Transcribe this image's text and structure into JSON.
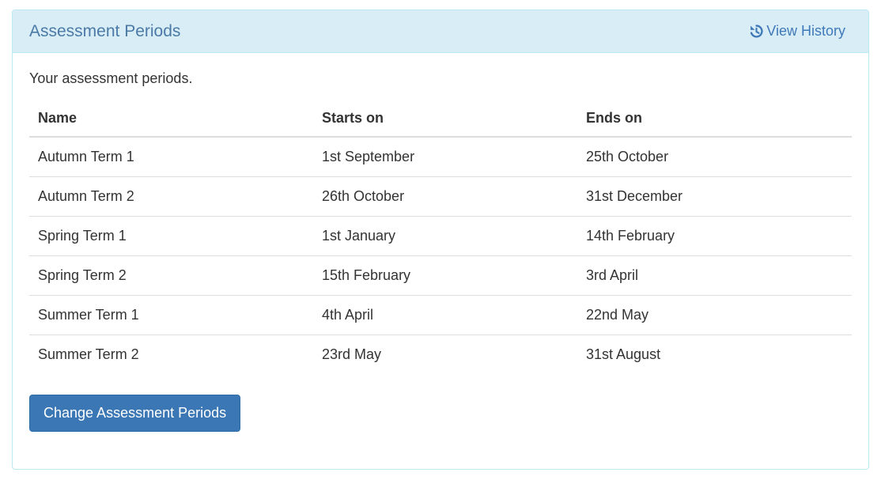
{
  "panel": {
    "title": "Assessment Periods",
    "history_link": "View History",
    "intro": "Your assessment periods."
  },
  "table": {
    "headers": [
      "Name",
      "Starts on",
      "Ends on"
    ],
    "rows": [
      [
        "Autumn Term 1",
        "1st September",
        "25th October"
      ],
      [
        "Autumn Term 2",
        "26th October",
        "31st December"
      ],
      [
        "Spring Term 1",
        "1st January",
        "14th February"
      ],
      [
        "Spring Term 2",
        "15th February",
        "3rd April"
      ],
      [
        "Summer Term 1",
        "4th April",
        "22nd May"
      ],
      [
        "Summer Term 2",
        "23rd May",
        "31st August"
      ]
    ]
  },
  "actions": {
    "change_button": "Change Assessment Periods"
  },
  "icons": {
    "history": "history-icon"
  },
  "colors": {
    "heading_bg": "#d9edf7",
    "heading_text": "#4a7aa5",
    "link": "#3f79b8",
    "button_bg": "#3b77b5"
  }
}
